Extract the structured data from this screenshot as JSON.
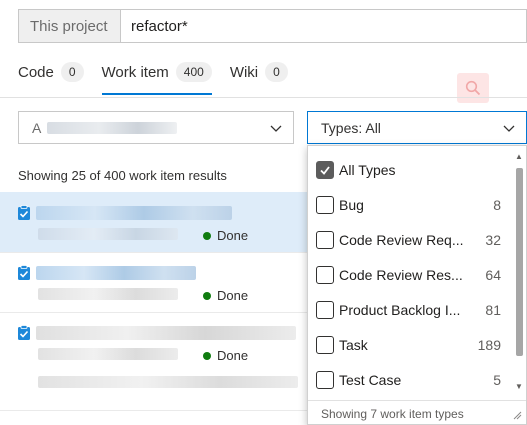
{
  "search": {
    "scope_label": "This project",
    "query": "refactor*"
  },
  "tabs": [
    {
      "label": "Code",
      "count": "0"
    },
    {
      "label": "Work item",
      "count": "400"
    },
    {
      "label": "Wiki",
      "count": "0"
    }
  ],
  "filters": {
    "area_prefix": "A",
    "types_label": "Types: All"
  },
  "summary": "Showing 25 of 400 work item results",
  "results": [
    {
      "status": "Done"
    },
    {
      "status": "Done"
    },
    {
      "status": "Done"
    }
  ],
  "types_dropdown": {
    "options": [
      {
        "label": "All Types",
        "count": "",
        "checked": true
      },
      {
        "label": "Bug",
        "count": "8",
        "checked": false
      },
      {
        "label": "Code Review Req...",
        "count": "32",
        "checked": false
      },
      {
        "label": "Code Review Res...",
        "count": "64",
        "checked": false
      },
      {
        "label": "Product Backlog I...",
        "count": "81",
        "checked": false
      },
      {
        "label": "Task",
        "count": "189",
        "checked": false
      },
      {
        "label": "Test Case",
        "count": "5",
        "checked": false
      }
    ],
    "footer": "Showing 7 work item types"
  },
  "colors": {
    "accent": "#0078d4",
    "done": "#107c10",
    "selected_row": "#deecf9"
  }
}
